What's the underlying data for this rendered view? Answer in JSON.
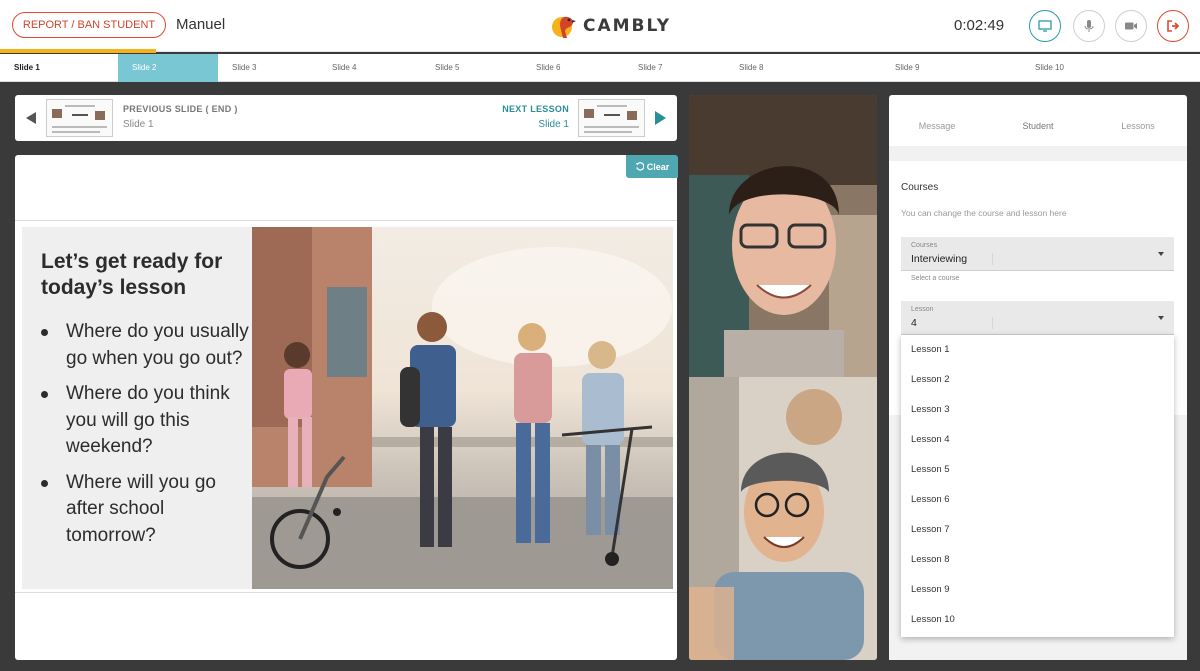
{
  "header": {
    "report_label": "REPORT / BAN STUDENT",
    "tutor_name": "Manuel",
    "logo_text": "CAMBLY",
    "timer": "0:02:49",
    "accent_color": "#2a9aa8",
    "danger_color": "#e04a2e"
  },
  "tabs": [
    "Slide 1",
    "Slide 2",
    "Slide 3",
    "Slide 4",
    "Slide 5",
    "Slide 6",
    "Slide 7",
    "Slide 8",
    "Slide 9",
    "Slide 10"
  ],
  "slide_nav": {
    "prev_title": "PREVIOUS SLIDE ( END )",
    "prev_sub": "Slide 1",
    "next_title": "NEXT LESSON",
    "next_sub": "Slide 1"
  },
  "slide": {
    "clear_label": "Clear",
    "title": "Let’s get ready for today’s lesson",
    "bullets": [
      "Where do you usually go when you go out?",
      "Where do you think you will go this weekend?",
      "Where will you go after school tomorrow?"
    ]
  },
  "panel": {
    "tabs": [
      "Message",
      "Student",
      "Lessons"
    ],
    "courses_heading": "Courses",
    "courses_desc": "You can change the course and lesson here",
    "course_label": "Courses",
    "course_value": "Interviewing",
    "course_helper": "Select a course",
    "lesson_label": "Lesson",
    "lesson_value": "4",
    "lesson_options": [
      "Lesson 1",
      "Lesson 2",
      "Lesson 3",
      "Lesson 4",
      "Lesson 5",
      "Lesson 6",
      "Lesson 7",
      "Lesson 8",
      "Lesson 9",
      "Lesson 10"
    ]
  }
}
